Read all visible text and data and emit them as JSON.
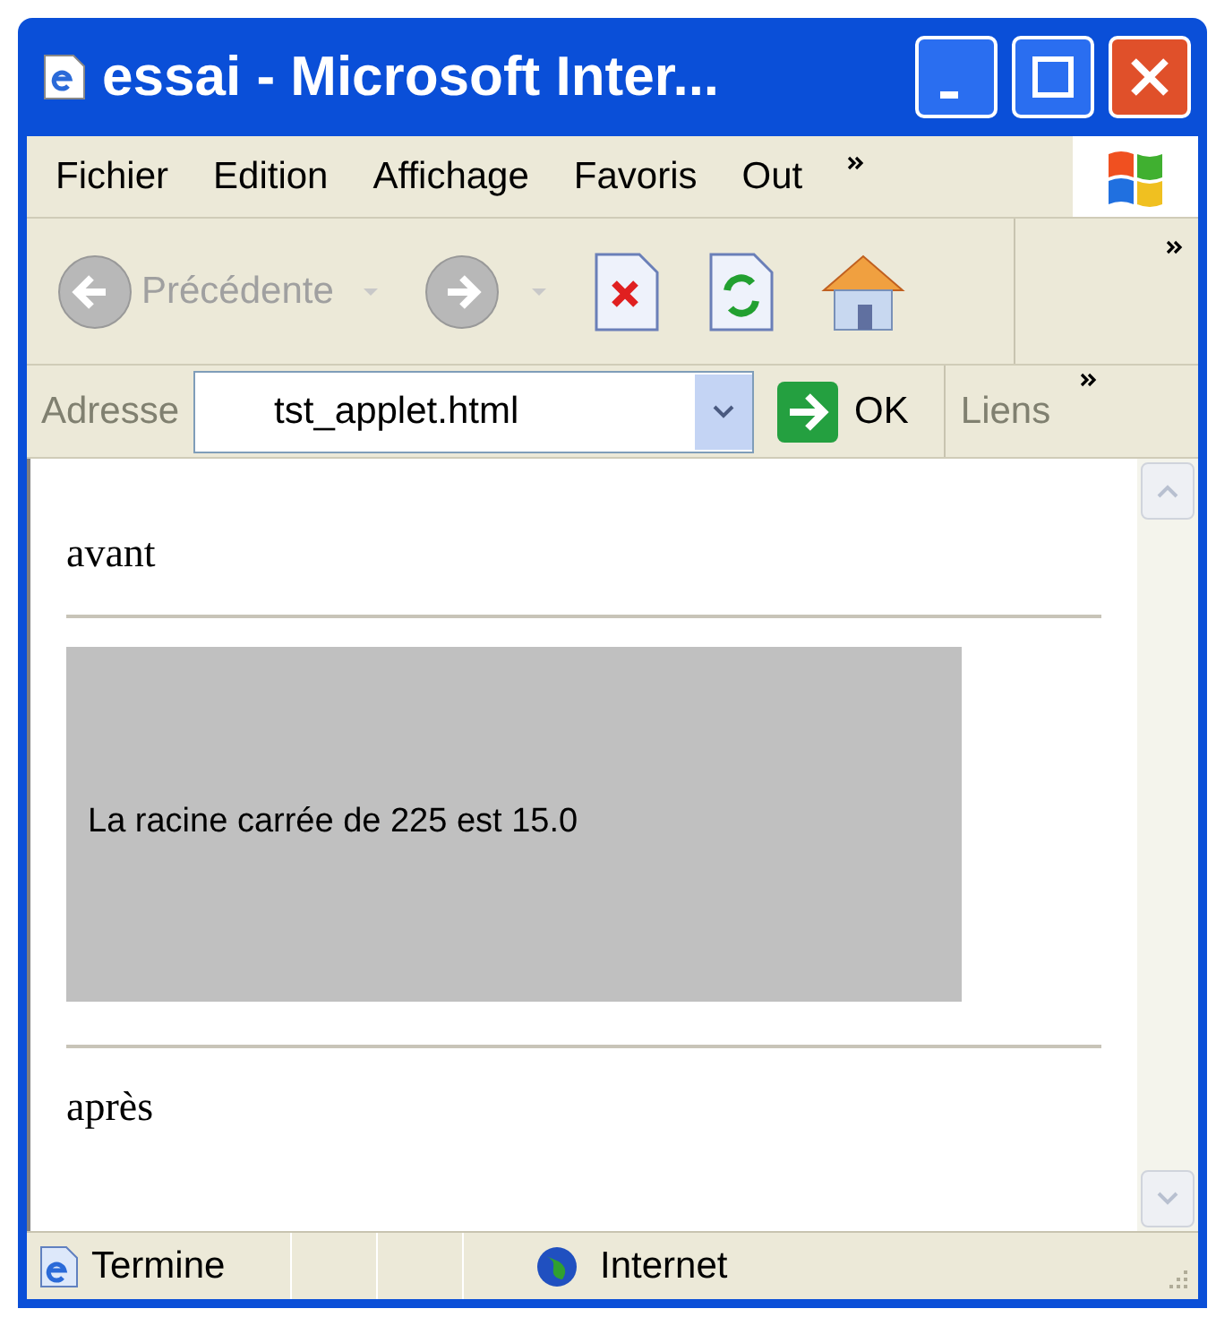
{
  "window": {
    "title": "essai - Microsoft Inter..."
  },
  "menu": [
    "Fichier",
    "Edition",
    "Affichage",
    "Favoris",
    "Out"
  ],
  "toolbar": {
    "buttons": [
      {
        "kind": "back",
        "label": "Précédente",
        "disabled": true
      },
      {
        "kind": "forward",
        "disabled": true
      },
      {
        "kind": "stop",
        "disabled": false
      },
      {
        "kind": "refresh",
        "disabled": false
      },
      {
        "kind": "home",
        "disabled": false
      }
    ]
  },
  "address_bar": {
    "label": "Adresse",
    "value": "tst_applet.html",
    "go": "OK",
    "links": "Liens"
  },
  "page": {
    "before": "avant",
    "applet_text": "La racine carrée de 225 est 15.0",
    "after": "après"
  },
  "status_bar": {
    "status": "Termine",
    "zone": "Internet"
  }
}
